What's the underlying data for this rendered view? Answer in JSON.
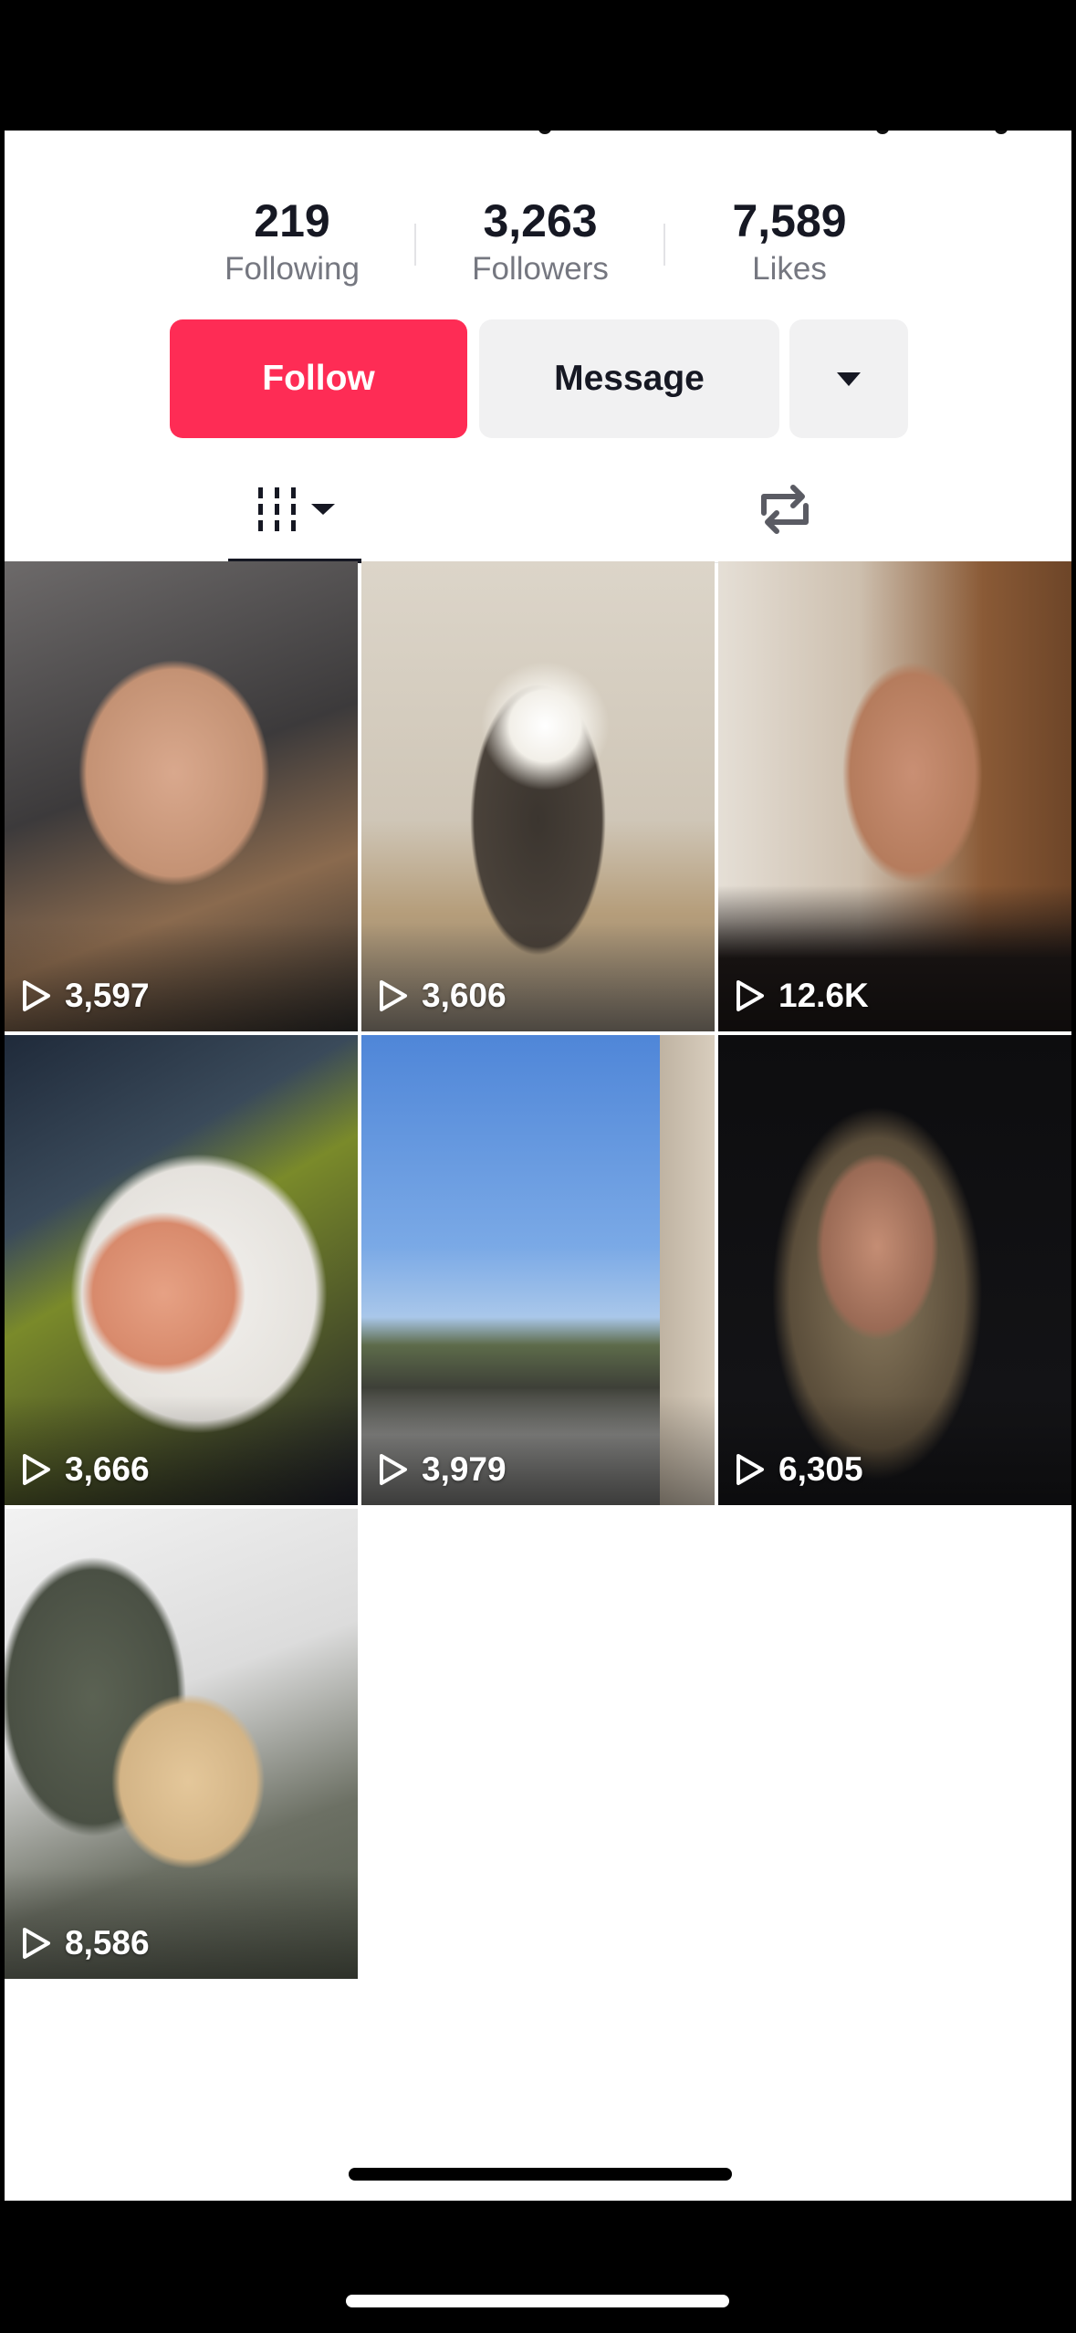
{
  "profile": {
    "stats": [
      {
        "value": "219",
        "label": "Following"
      },
      {
        "value": "3,263",
        "label": "Followers"
      },
      {
        "value": "7,589",
        "label": "Likes"
      }
    ]
  },
  "actions": {
    "follow_label": "Follow",
    "message_label": "Message",
    "more_icon": "caret-down-icon"
  },
  "tabs": {
    "videos_icon": "grid-filter-icon",
    "repost_icon": "repost-icon",
    "active": "videos"
  },
  "videos": [
    {
      "views": "3,597"
    },
    {
      "views": "3,606"
    },
    {
      "views": "12.6K"
    },
    {
      "views": "3,666"
    },
    {
      "views": "3,979"
    },
    {
      "views": "6,305"
    },
    {
      "views": "8,586"
    }
  ],
  "colors": {
    "accent": "#fe2c55",
    "button_gray": "#f1f1f2",
    "text_primary": "#161823",
    "text_secondary": "#757780"
  }
}
